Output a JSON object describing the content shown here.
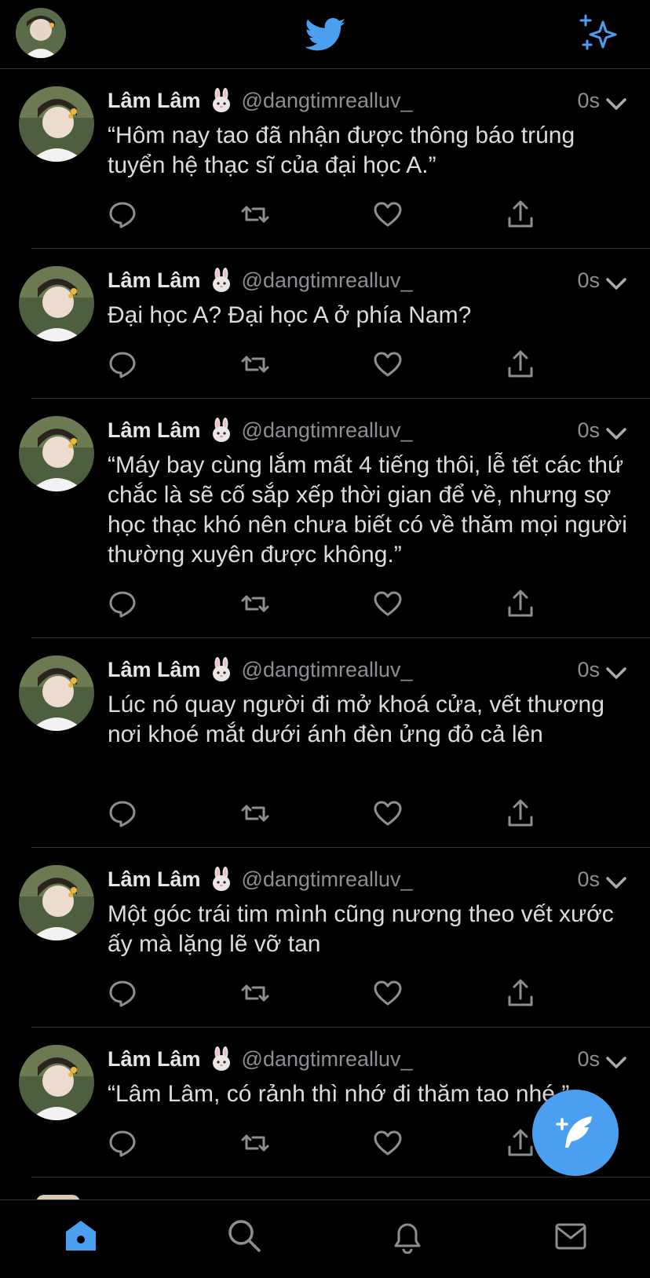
{
  "app": {
    "accent_color": "#4b9ff0",
    "top_bar": {
      "left": "profile-avatar",
      "center": "twitter-bird-icon",
      "right": "sparkle-icon"
    }
  },
  "tweets": [
    {
      "name": "Lâm Lâm",
      "emoji": "rabbit-face-icon",
      "handle": "@dangtimrealluv_",
      "time": "0s",
      "text": "“Hôm nay tao đã nhận được thông báo trúng tuyển hệ thạc sĩ của đại học A.”"
    },
    {
      "name": "Lâm Lâm",
      "emoji": "rabbit-face-icon",
      "handle": "@dangtimrealluv_",
      "time": "0s",
      "text": "Đại học A? Đại học A ở phía Nam?"
    },
    {
      "name": "Lâm Lâm",
      "emoji": "rabbit-face-icon",
      "handle": "@dangtimrealluv_",
      "time": "0s",
      "text": "“Máy bay cùng lắm mất 4 tiếng thôi, lễ tết các thứ chắc là sẽ cố sắp xếp thời gian để về, nhưng sợ học thạc khó nên chưa biết có về thăm mọi người thường xuyên được không.”"
    },
    {
      "name": "Lâm Lâm",
      "emoji": "rabbit-face-icon",
      "handle": "@dangtimrealluv_",
      "time": "0s",
      "text": "Lúc nó quay người đi mở khoá cửa, vết thương nơi khoé mắt dưới ánh đèn ửng đỏ cả lên"
    },
    {
      "name": "Lâm Lâm",
      "emoji": "rabbit-face-icon",
      "handle": "@dangtimrealluv_",
      "time": "0s",
      "text": "Một góc trái tim mình cũng nương theo vết xước ấy mà lặng lẽ vỡ tan"
    },
    {
      "name": "Lâm Lâm",
      "emoji": "rabbit-face-icon",
      "handle": "@dangtimrealluv_",
      "time": "0s",
      "text": "“Lâm Lâm, có rảnh thì nhớ đi thăm tao nhé.”"
    }
  ],
  "tab_bar": {
    "items": [
      "home-icon",
      "search-icon",
      "notifications-bell-icon",
      "messages-envelope-icon"
    ],
    "active": "home-icon"
  },
  "compose_button": "compose-feather-icon"
}
